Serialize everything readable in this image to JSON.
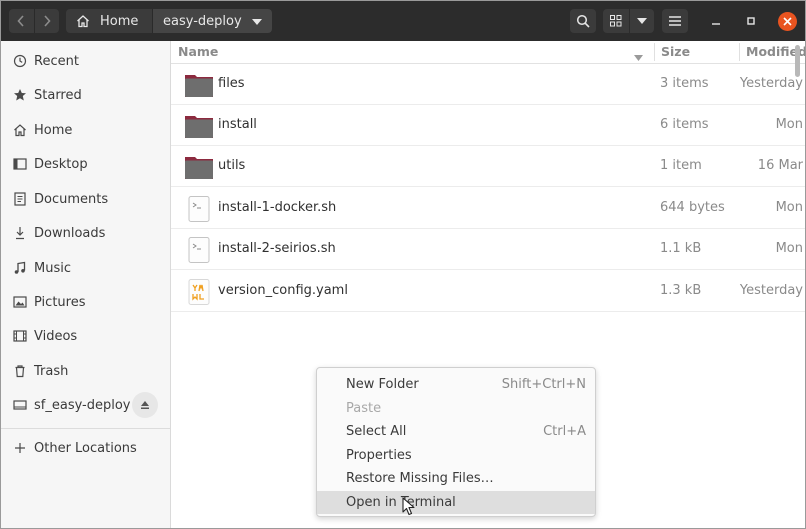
{
  "header": {
    "breadcrumb": [
      {
        "label": "Home",
        "icon": "home-icon"
      },
      {
        "label": "easy-deploy",
        "icon": "chevron-down-icon"
      }
    ],
    "buttons": [
      "search-icon",
      "grid-view-icon",
      "view-options-chevron-icon",
      "hamburger-menu-icon"
    ],
    "window_controls": [
      "minimize-icon",
      "maximize-icon",
      "close-icon"
    ],
    "accent_color": "#e95420"
  },
  "sidebar": {
    "items": [
      {
        "label": "Recent",
        "icon": "clock-icon"
      },
      {
        "label": "Starred",
        "icon": "star-icon"
      },
      {
        "label": "Home",
        "icon": "home-icon"
      },
      {
        "label": "Desktop",
        "icon": "desktop-icon"
      },
      {
        "label": "Documents",
        "icon": "document-icon"
      },
      {
        "label": "Downloads",
        "icon": "download-icon"
      },
      {
        "label": "Music",
        "icon": "music-icon"
      },
      {
        "label": "Pictures",
        "icon": "picture-icon"
      },
      {
        "label": "Videos",
        "icon": "video-icon"
      },
      {
        "label": "Trash",
        "icon": "trash-icon"
      },
      {
        "label": "sf_easy-deploy",
        "icon": "drive-icon"
      }
    ],
    "other": {
      "label": "Other Locations",
      "icon": "plus-icon"
    }
  },
  "columns": {
    "name": "Name",
    "size": "Size",
    "modified": "Modified"
  },
  "files": [
    {
      "name": "files",
      "size": "3 items",
      "modified": "Yesterday",
      "type": "folder"
    },
    {
      "name": "install",
      "size": "6 items",
      "modified": "Mon",
      "type": "folder"
    },
    {
      "name": "utils",
      "size": "1 item",
      "modified": "16 Mar",
      "type": "folder"
    },
    {
      "name": "install-1-docker.sh",
      "size": "644 bytes",
      "modified": "Mon",
      "type": "script"
    },
    {
      "name": "install-2-seirios.sh",
      "size": "1.1 kB",
      "modified": "Mon",
      "type": "script"
    },
    {
      "name": "version_config.yaml",
      "size": "1.3 kB",
      "modified": "Yesterday",
      "type": "yaml"
    }
  ],
  "context_menu": [
    {
      "label": "New Folder",
      "shortcut": "Shift+Ctrl+N",
      "enabled": true
    },
    {
      "label": "Paste",
      "shortcut": "",
      "enabled": false
    },
    {
      "label": "Select All",
      "shortcut": "Ctrl+A",
      "enabled": true
    },
    {
      "label": "Properties",
      "shortcut": "",
      "enabled": true
    },
    {
      "label": "Restore Missing Files…",
      "shortcut": "",
      "enabled": true
    },
    {
      "label": "Open in Terminal",
      "shortcut": "",
      "enabled": true,
      "hovered": true
    }
  ]
}
